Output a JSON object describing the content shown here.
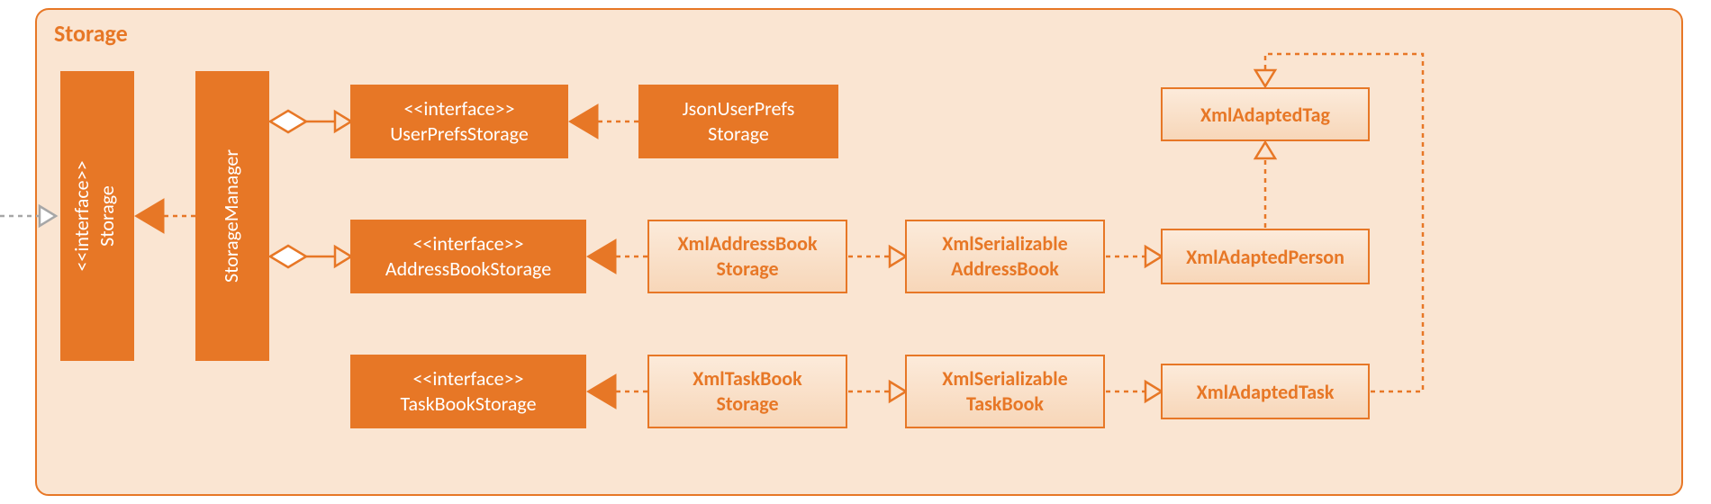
{
  "package": {
    "title": "Storage"
  },
  "nodes": {
    "storage_interface": {
      "stereotype": "<<interface>>",
      "name": "Storage"
    },
    "storage_manager": {
      "name": "StorageManager"
    },
    "userprefs_interface": {
      "stereotype": "<<interface>>",
      "name": "UserPrefsStorage"
    },
    "addressbook_interface": {
      "stereotype": "<<interface>>",
      "name": "AddressBookStorage"
    },
    "taskbook_interface": {
      "stereotype": "<<interface>>",
      "name": "TaskBookStorage"
    },
    "json_userprefs": {
      "line1": "JsonUserPrefs",
      "line2": "Storage"
    },
    "xml_addressbook_storage": {
      "line1": "XmlAddressBook",
      "line2": "Storage"
    },
    "xml_taskbook_storage": {
      "line1": "XmlTaskBook",
      "line2": "Storage"
    },
    "xml_ser_addressbook": {
      "line1": "XmlSerializable",
      "line2": "AddressBook"
    },
    "xml_ser_taskbook": {
      "line1": "XmlSerializable",
      "line2": "TaskBook"
    },
    "xml_adapted_tag": {
      "name": "XmlAdaptedTag"
    },
    "xml_adapted_person": {
      "name": "XmlAdaptedPerson"
    },
    "xml_adapted_task": {
      "name": "XmlAdaptedTask"
    }
  },
  "chart_data": {
    "type": "uml-class-diagram",
    "package": "Storage",
    "classes": [
      {
        "id": "Storage",
        "stereotype": "interface",
        "style": "solid"
      },
      {
        "id": "StorageManager",
        "style": "solid"
      },
      {
        "id": "UserPrefsStorage",
        "stereotype": "interface",
        "style": "solid"
      },
      {
        "id": "AddressBookStorage",
        "stereotype": "interface",
        "style": "solid"
      },
      {
        "id": "TaskBookStorage",
        "stereotype": "interface",
        "style": "solid"
      },
      {
        "id": "JsonUserPrefsStorage",
        "style": "solid"
      },
      {
        "id": "XmlAddressBookStorage",
        "style": "light"
      },
      {
        "id": "XmlTaskBookStorage",
        "style": "light"
      },
      {
        "id": "XmlSerializableAddressBook",
        "style": "light"
      },
      {
        "id": "XmlSerializableTaskBook",
        "style": "light"
      },
      {
        "id": "XmlAdaptedTag",
        "style": "light"
      },
      {
        "id": "XmlAdaptedPerson",
        "style": "light"
      },
      {
        "id": "XmlAdaptedTask",
        "style": "light"
      }
    ],
    "relations": [
      {
        "from": "(external)",
        "to": "Storage",
        "kind": "dependency"
      },
      {
        "from": "StorageManager",
        "to": "Storage",
        "kind": "realization"
      },
      {
        "from": "StorageManager",
        "to": "UserPrefsStorage",
        "kind": "aggregation"
      },
      {
        "from": "StorageManager",
        "to": "AddressBookStorage",
        "kind": "aggregation"
      },
      {
        "from": "JsonUserPrefsStorage",
        "to": "UserPrefsStorage",
        "kind": "realization"
      },
      {
        "from": "XmlAddressBookStorage",
        "to": "AddressBookStorage",
        "kind": "realization"
      },
      {
        "from": "XmlTaskBookStorage",
        "to": "TaskBookStorage",
        "kind": "realization"
      },
      {
        "from": "XmlAddressBookStorage",
        "to": "XmlSerializableAddressBook",
        "kind": "dependency"
      },
      {
        "from": "XmlTaskBookStorage",
        "to": "XmlSerializableTaskBook",
        "kind": "dependency"
      },
      {
        "from": "XmlSerializableAddressBook",
        "to": "XmlAdaptedPerson",
        "kind": "dependency"
      },
      {
        "from": "XmlSerializableTaskBook",
        "to": "XmlAdaptedTask",
        "kind": "dependency"
      },
      {
        "from": "XmlAdaptedPerson",
        "to": "XmlAdaptedTag",
        "kind": "dependency"
      },
      {
        "from": "XmlAdaptedTask",
        "to": "XmlAdaptedTag",
        "kind": "dependency-routed"
      }
    ]
  }
}
